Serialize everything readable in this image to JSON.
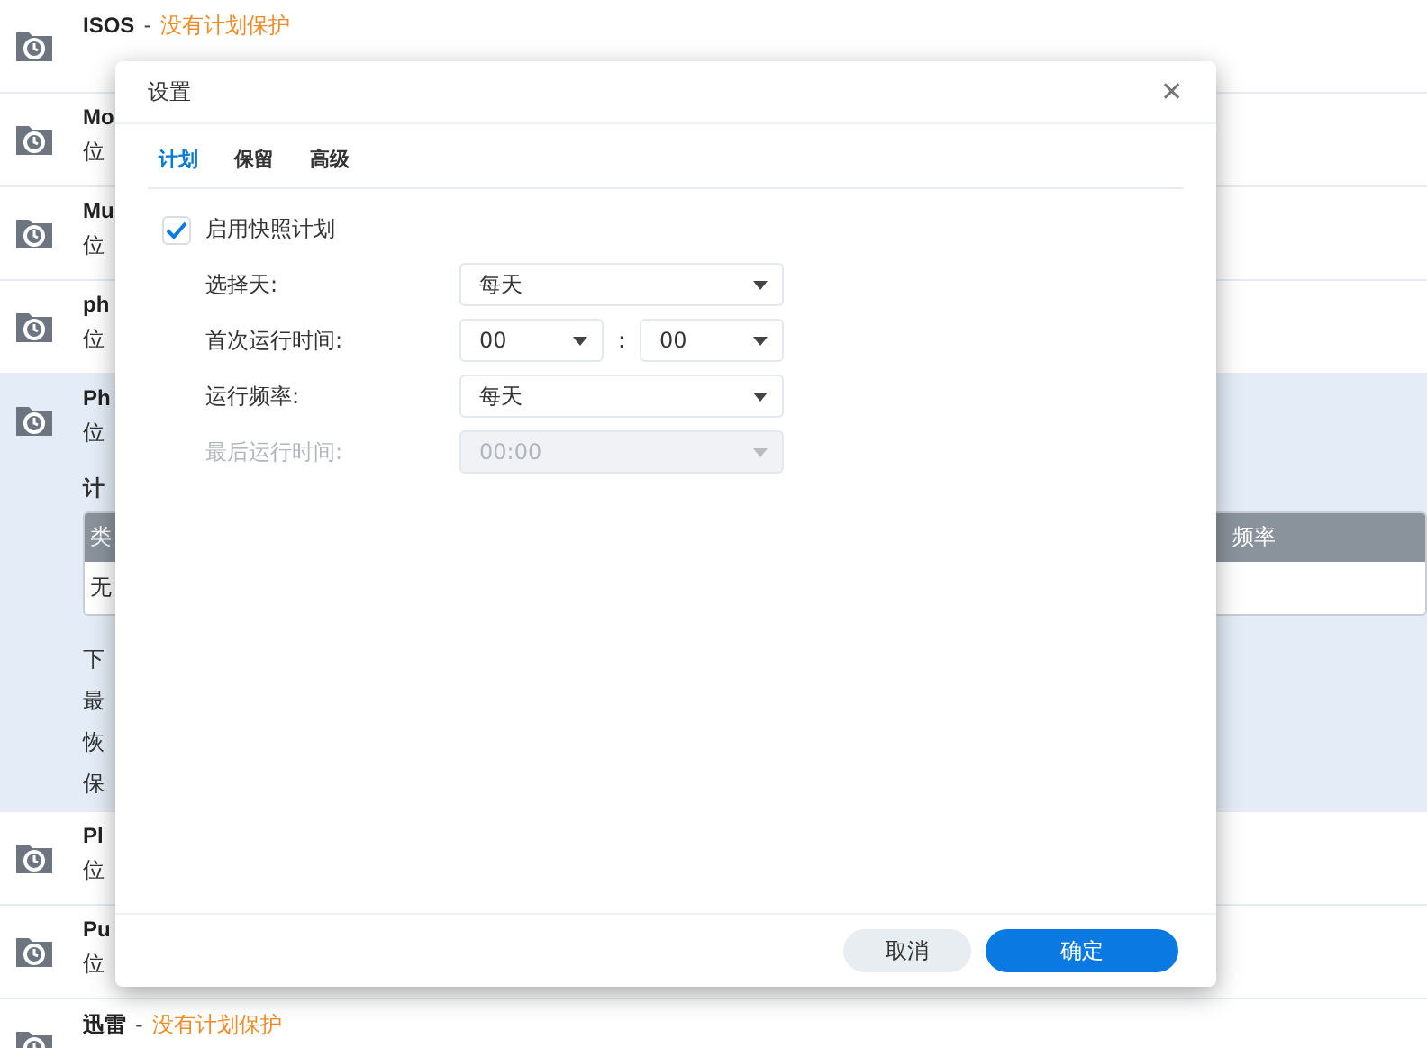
{
  "shares": [
    {
      "name": "ISOS",
      "separator": "-",
      "status": "没有计划保护",
      "expanded": false
    },
    {
      "name": "Mo",
      "location": "位",
      "expanded": false
    },
    {
      "name": "Mu",
      "location": "位",
      "expanded": false
    },
    {
      "name": "ph",
      "location": "位",
      "expanded": false
    },
    {
      "name": "Ph",
      "location": "位",
      "expanded": true,
      "section_title": "计",
      "table": {
        "columns": [
          "类",
          "频率"
        ],
        "rows": [
          [
            "无"
          ]
        ]
      },
      "details": [
        "下",
        "最",
        "恢",
        "保"
      ]
    },
    {
      "name": "Pl",
      "location": "位",
      "expanded": false
    },
    {
      "name": "Pu",
      "location": "位",
      "expanded": false
    },
    {
      "name": "迅雷",
      "separator": "-",
      "status": "没有计划保护",
      "expanded": false
    }
  ],
  "dialog": {
    "title": "设置",
    "close": "✕",
    "tabs": [
      {
        "label": "计划",
        "selected": true
      },
      {
        "label": "保留",
        "selected": false
      },
      {
        "label": "高级",
        "selected": false
      }
    ],
    "enable": {
      "label": "启用快照计划",
      "checked": true
    },
    "fields": [
      {
        "kind": "select",
        "label": "选择天:",
        "value": "每天",
        "disabled": false
      },
      {
        "kind": "time",
        "label": "首次运行时间:",
        "hour": "00",
        "colon": ":",
        "minute": "00",
        "disabled": false
      },
      {
        "kind": "select",
        "label": "运行频率:",
        "value": "每天",
        "disabled": false
      },
      {
        "kind": "select",
        "label": "最后运行时间:",
        "value": "00:00",
        "disabled": true
      }
    ],
    "buttons": [
      {
        "label": "取消",
        "kind": "secondary"
      },
      {
        "label": "确定",
        "kind": "primary"
      }
    ]
  }
}
